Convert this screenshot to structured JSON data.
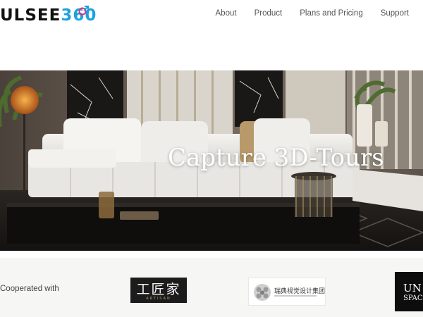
{
  "brand": {
    "logo_dark": "ULSEE",
    "logo_accent": "360",
    "accent_color": "#1aa3e0"
  },
  "nav": {
    "items": [
      {
        "label": "About"
      },
      {
        "label": "Product"
      },
      {
        "label": "Plans and Pricing"
      },
      {
        "label": "Support"
      }
    ]
  },
  "hero": {
    "title": "Capture 3D-Tours"
  },
  "partners": {
    "label": "Cooperated with",
    "logos": [
      {
        "text": "工匠家",
        "sub": "ARTISAN"
      },
      {
        "text": "瑞典视觉设计集团"
      },
      {
        "line1": "UN",
        "line2": "SPAC"
      }
    ]
  }
}
